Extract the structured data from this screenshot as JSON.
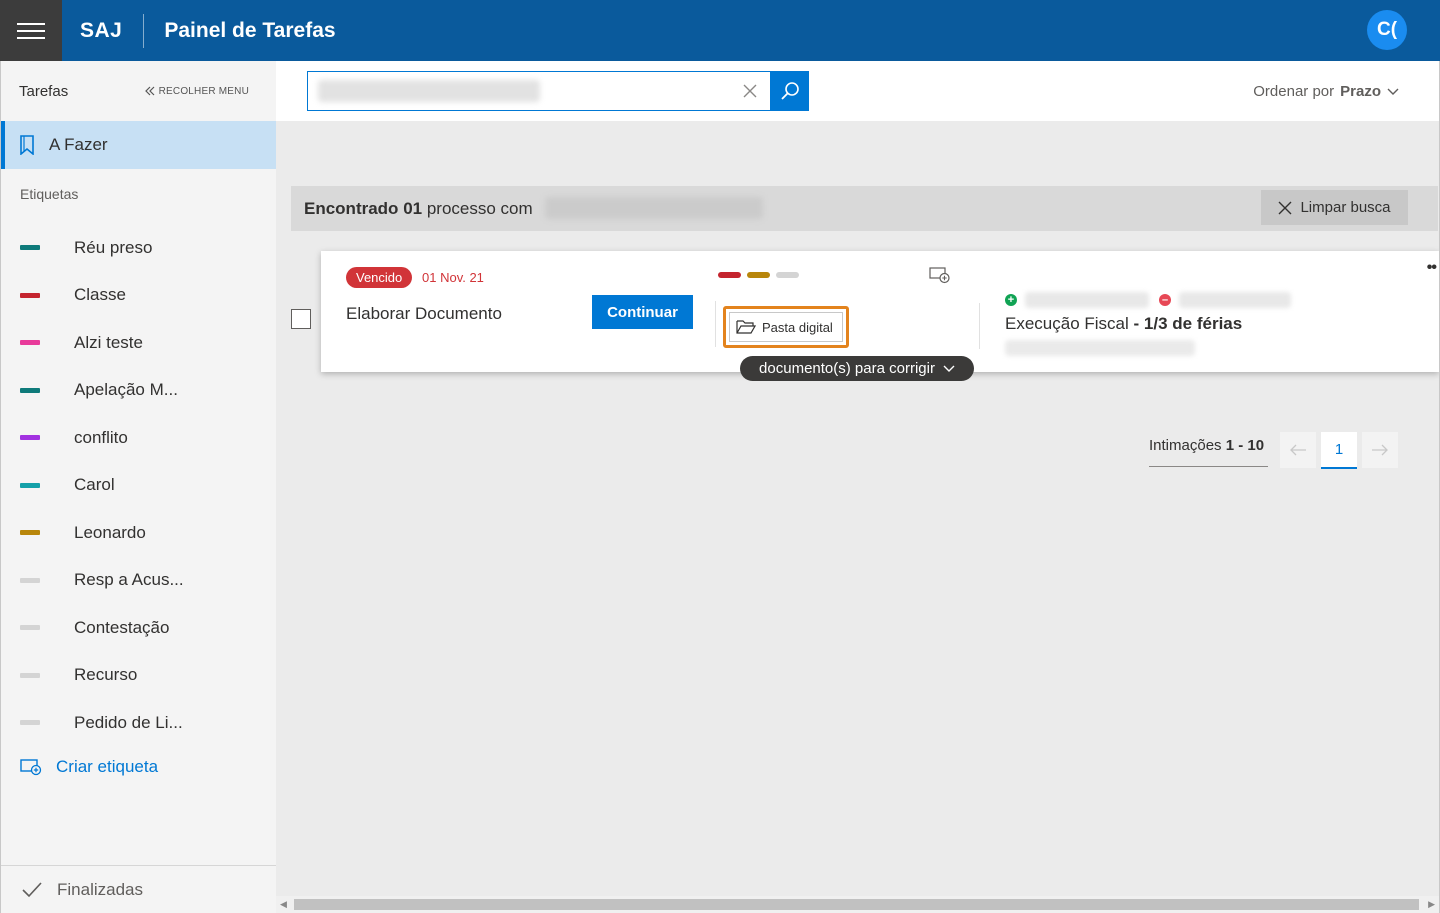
{
  "header": {
    "brand": "SAJ",
    "title": "Painel de Tarefas",
    "avatar_initials": "C(",
    "bg_color": "#0a5a9c"
  },
  "sidebar": {
    "section_title": "Tarefas",
    "collapse_label": "RECOLHER MENU",
    "todo_label": "A Fazer",
    "tags_title": "Etiquetas",
    "tags": [
      {
        "name": "Réu preso",
        "color": "#0e7a7a"
      },
      {
        "name": "Classe",
        "color": "#c4242e"
      },
      {
        "name": "Alzi teste",
        "color": "#e83a9a"
      },
      {
        "name": "Apelação M...",
        "color": "#0e7a7a"
      },
      {
        "name": "conflito",
        "color": "#a232e0"
      },
      {
        "name": "Carol",
        "color": "#14a0a8"
      },
      {
        "name": "Leonardo",
        "color": "#b8860b"
      },
      {
        "name": "Resp a Acus...",
        "color": "#d4d4d4"
      },
      {
        "name": "Contestação",
        "color": "#d4d4d4"
      },
      {
        "name": "Recurso",
        "color": "#d4d4d4"
      },
      {
        "name": "Pedido de Li...",
        "color": "#d4d4d4"
      }
    ],
    "create_tag_label": "Criar etiqueta",
    "finished_label": "Finalizadas"
  },
  "search": {
    "value": "",
    "order_label": "Ordenar por",
    "order_value": "Prazo"
  },
  "results": {
    "found_label": "Encontrado",
    "found_count": "01",
    "found_suffix": "processo com",
    "clear_label": "Limpar busca"
  },
  "task": {
    "status": "Vencido",
    "due_date": "01 Nov. 21",
    "title": "Elaborar Documento",
    "continue_label": "Continuar",
    "tag_colors": [
      "#c4242e",
      "#b8860b",
      "#d4d4d4"
    ],
    "folder_label": "Pasta digital",
    "process_class": "Execução Fiscal",
    "process_detail": "1/3 de férias",
    "docs_label": "documento(s) para corrigir"
  },
  "pagination": {
    "label": "Intimações",
    "range": "1 - 10",
    "current_page": "1"
  }
}
